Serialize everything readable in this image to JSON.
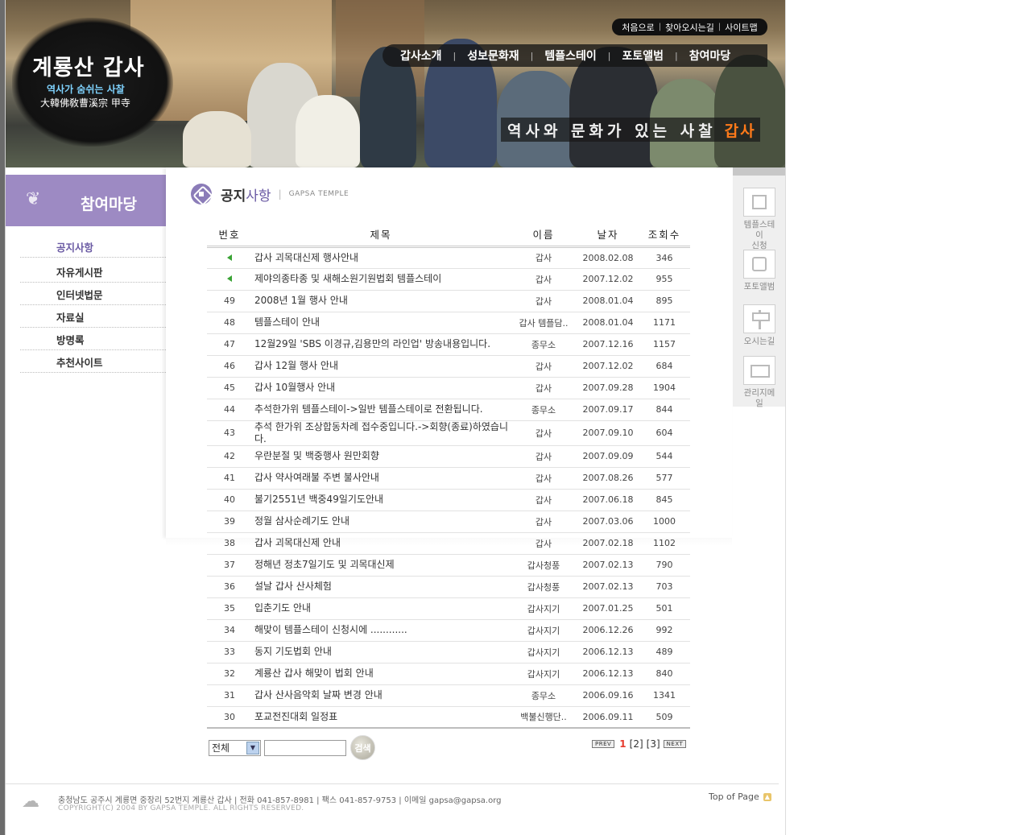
{
  "header": {
    "logo_title": "계룡산 갑사",
    "logo_sub1": "역사가 숨쉬는 사찰",
    "logo_sub2": "大韓佛敎曹溪宗 甲寺",
    "util_links": [
      "처음으로",
      "찾아오시는길",
      "사이트맵"
    ],
    "gnb": [
      "갑사소개",
      "성보문화재",
      "템플스테이",
      "포토앨범",
      "참여마당"
    ],
    "slogan": "역사와 문화가 있는 사찰",
    "slogan_highlight": "갑사"
  },
  "section": {
    "title": "참여마당",
    "menu": [
      "공지사항",
      "자유게시판",
      "인터넷법문",
      "자료실",
      "방명록",
      "추천사이트"
    ],
    "active_index": 0
  },
  "page": {
    "title_a": "공지",
    "title_b": "사항",
    "title_en": "GAPSA TEMPLE"
  },
  "board": {
    "columns": [
      "번호",
      "제목",
      "이름",
      "날자",
      "조회수"
    ],
    "rows": [
      {
        "num": "",
        "notice": true,
        "subject": "갑사 괴목대신제 행사안내",
        "name": "갑사",
        "date": "2008.02.08",
        "views": "346"
      },
      {
        "num": "",
        "notice": true,
        "subject": "제야의종타종 및 새해소원기원법회 템플스테이",
        "name": "갑사",
        "date": "2007.12.02",
        "views": "955"
      },
      {
        "num": "49",
        "subject": "2008년 1월 행사 안내",
        "name": "갑사",
        "date": "2008.01.04",
        "views": "895"
      },
      {
        "num": "48",
        "subject": "템플스테이 안내",
        "name": "갑사 템플담..",
        "date": "2008.01.04",
        "views": "1171"
      },
      {
        "num": "47",
        "subject": "12월29일 'SBS 이경규,김용만의 라인업' 방송내용입니다.",
        "name": "종무소",
        "date": "2007.12.16",
        "views": "1157"
      },
      {
        "num": "46",
        "subject": "갑사 12월 행사 안내",
        "name": "갑사",
        "date": "2007.12.02",
        "views": "684"
      },
      {
        "num": "45",
        "subject": "갑사 10월행사 안내",
        "name": "갑사",
        "date": "2007.09.28",
        "views": "1904"
      },
      {
        "num": "44",
        "subject": "추석한가위 템플스테이->일반 템플스테이로 전환됩니다.",
        "name": "종무소",
        "date": "2007.09.17",
        "views": "844"
      },
      {
        "num": "43",
        "subject": "추석 한가위 조상합동차례 접수중입니다.->회향(종료)하였습니다.",
        "name": "갑사",
        "date": "2007.09.10",
        "views": "604",
        "tall": true
      },
      {
        "num": "42",
        "subject": "우란분절 및 백중행사 원만회향",
        "name": "갑사",
        "date": "2007.09.09",
        "views": "544"
      },
      {
        "num": "41",
        "subject": "갑사 약사여래불 주변 불사안내",
        "name": "갑사",
        "date": "2007.08.26",
        "views": "577"
      },
      {
        "num": "40",
        "subject": "불기2551년 백중49일기도안내",
        "name": "갑사",
        "date": "2007.06.18",
        "views": "845"
      },
      {
        "num": "39",
        "subject": "정월 삼사순례기도 안내",
        "name": "갑사",
        "date": "2007.03.06",
        "views": "1000"
      },
      {
        "num": "38",
        "subject": "갑사 괴목대신제 안내",
        "name": "갑사",
        "date": "2007.02.18",
        "views": "1102"
      },
      {
        "num": "37",
        "subject": "정해년 정초7일기도 및 괴목대신제",
        "name": "갑사청풍",
        "date": "2007.02.13",
        "views": "790"
      },
      {
        "num": "36",
        "subject": "설날 갑사 산사체험",
        "name": "갑사청풍",
        "date": "2007.02.13",
        "views": "703"
      },
      {
        "num": "35",
        "subject": "입춘기도 안내",
        "name": "갑사지기",
        "date": "2007.01.25",
        "views": "501"
      },
      {
        "num": "34",
        "subject": "해맞이 템플스테이 신청시에 ............",
        "name": "갑사지기",
        "date": "2006.12.26",
        "views": "992"
      },
      {
        "num": "33",
        "subject": "동지 기도법회 안내",
        "name": "갑사지기",
        "date": "2006.12.13",
        "views": "489"
      },
      {
        "num": "32",
        "subject": "계룡산 갑사 해맞이 법회 안내",
        "name": "갑사지기",
        "date": "2006.12.13",
        "views": "840"
      },
      {
        "num": "31",
        "subject": "갑사 산사음악회 날짜 변경 안내",
        "name": "종무소",
        "date": "2006.09.16",
        "views": "1341"
      },
      {
        "num": "30",
        "subject": "포교전진대회 일정표",
        "name": "백불신행단..",
        "date": "2006.09.11",
        "views": "509"
      }
    ]
  },
  "search": {
    "field_selected": "전체",
    "keyword": "",
    "button": "검색"
  },
  "paging": {
    "prev": "PREV",
    "next": "NEXT",
    "current": "1",
    "pages": [
      "[2]",
      "[3]"
    ]
  },
  "quick_menu": [
    {
      "label": "템플스테이\n신청",
      "icon": "register-icon"
    },
    {
      "label": "포토앨범",
      "icon": "photo-icon"
    },
    {
      "label": "오시는길",
      "icon": "signpost-icon"
    },
    {
      "label": "관리지메일",
      "icon": "mail-icon"
    }
  ],
  "footer": {
    "address": "충청남도 공주시 계룡면 중장리 52번지  계룡산 갑사  |  전화 041-857-8981  |  팩스 041-857-9753  |  이메일 gapsa@gapsa.org",
    "copyright": "COPYRIGHT(C) 2004 BY GAPSA TEMPLE. ALL RIGHTS RESERVED.",
    "top_link": "Top of Page"
  },
  "colors": {
    "accent": "#9d8ac3",
    "highlight": "#ff7a1a",
    "notice": "#3aa335",
    "current_page": "#e63b2e"
  }
}
